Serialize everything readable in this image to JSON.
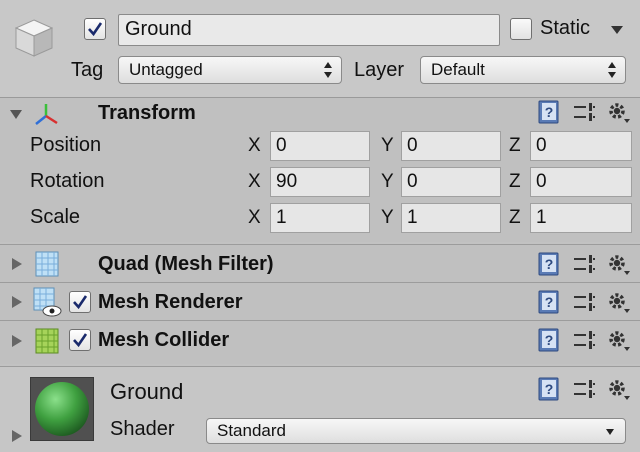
{
  "header": {
    "active_checked": true,
    "name_value": "Ground",
    "static_label": "Static",
    "static_checked": false,
    "tag_label": "Tag",
    "tag_value": "Untagged",
    "layer_label": "Layer",
    "layer_value": "Default"
  },
  "transform": {
    "title": "Transform",
    "rows": [
      {
        "label": "Position",
        "x": "0",
        "y": "0",
        "z": "0"
      },
      {
        "label": "Rotation",
        "x": "90",
        "y": "0",
        "z": "0"
      },
      {
        "label": "Scale",
        "x": "1",
        "y": "1",
        "z": "1"
      }
    ],
    "axis_labels": {
      "x": "X",
      "y": "Y",
      "z": "Z"
    }
  },
  "components": [
    {
      "title": "Quad (Mesh Filter)",
      "has_checkbox": false,
      "icon": "mesh-filter-icon"
    },
    {
      "title": "Mesh Renderer",
      "has_checkbox": true,
      "checked": true,
      "icon": "mesh-renderer-icon"
    },
    {
      "title": "Mesh Collider",
      "has_checkbox": true,
      "checked": true,
      "icon": "mesh-collider-icon"
    }
  ],
  "material": {
    "name": "Ground",
    "shader_label": "Shader",
    "shader_value": "Standard",
    "preview_color": "#3fa040"
  },
  "icons": [
    "cube-icon",
    "transform-axes-icon",
    "help-book-icon",
    "preset-sliders-icon",
    "settings-gear-icon",
    "foldout-arrow-icon",
    "checkmark-icon"
  ]
}
